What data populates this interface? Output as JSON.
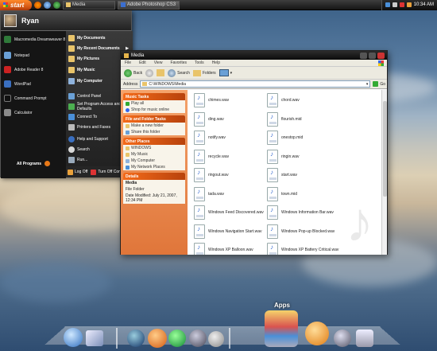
{
  "taskbar": {
    "start_label": "start",
    "tasks": [
      {
        "label": "Media"
      },
      {
        "label": "Adobe Photoshop CS3"
      }
    ],
    "clock": "10:34 AM"
  },
  "start_menu": {
    "user_name": "Ryan",
    "left_items": [
      {
        "label": "Macromedia Dreamweaver 8",
        "color": "#2f7a3a"
      },
      {
        "label": "Notepad",
        "color": "#6aa0d6"
      },
      {
        "label": "Adobe Reader 8",
        "color": "#c22"
      },
      {
        "label": "WordPad",
        "color": "#3a6fc0"
      },
      {
        "label": "Command Prompt",
        "color": "#222"
      },
      {
        "label": "Calculator",
        "color": "#8a8a8a"
      }
    ],
    "all_programs": "All Programs",
    "right_items": [
      {
        "label": "My Documents",
        "bold": true,
        "arrow": false
      },
      {
        "label": "My Recent Documents",
        "bold": true,
        "arrow": true
      },
      {
        "label": "My Pictures",
        "bold": true,
        "arrow": false
      },
      {
        "label": "My Music",
        "bold": true,
        "arrow": false
      },
      {
        "label": "My Computer",
        "bold": true,
        "arrow": false
      },
      {
        "label": "Control Panel",
        "bold": false,
        "arrow": false
      },
      {
        "label": "Set Program Access and Defaults",
        "bold": false,
        "arrow": false
      },
      {
        "label": "Connect To",
        "bold": false,
        "arrow": true
      },
      {
        "label": "Printers and Faxes",
        "bold": false,
        "arrow": false
      },
      {
        "label": "Help and Support",
        "bold": false,
        "arrow": false
      },
      {
        "label": "Search",
        "bold": false,
        "arrow": false
      },
      {
        "label": "Run...",
        "bold": false,
        "arrow": false
      }
    ],
    "log_off": "Log Off",
    "turn_off": "Turn Off Computer"
  },
  "explorer": {
    "title": "Media",
    "menu": [
      "File",
      "Edit",
      "View",
      "Favorites",
      "Tools",
      "Help"
    ],
    "toolbar": {
      "back": "Back",
      "search": "Search",
      "folders": "Folders"
    },
    "address_label": "Address",
    "address": "C:\\WINDOWS\\Media",
    "go": "Go",
    "task_pane": {
      "music_tasks": {
        "title": "Music Tasks",
        "items": [
          "Play all",
          "Shop for music online"
        ]
      },
      "file_tasks": {
        "title": "File and Folder Tasks",
        "items": [
          "Make a new folder",
          "Share this folder"
        ]
      },
      "other_places": {
        "title": "Other Places",
        "items": [
          "WINDOWS",
          "My Music",
          "My Computer",
          "My Network Places"
        ]
      },
      "details": {
        "title": "Details",
        "name": "Media",
        "type": "File Folder",
        "modified": "Date Modified: July 21, 2007, 12:34 PM"
      }
    },
    "files": [
      "chimes.wav",
      "chord.wav",
      "ding.wav",
      "flourish.mid",
      "notify.wav",
      "onestop.mid",
      "recycle.wav",
      "ringin.wav",
      "ringout.wav",
      "start.wav",
      "tada.wav",
      "town.mid",
      "Windows Feed Discovered.wav",
      "Windows Information Bar.wav",
      "Windows Navigation Start.wav",
      "Windows Pop-up Blocked.wav",
      "Windows XP Balloon.wav",
      "Windows XP Battery Critical.wav"
    ]
  },
  "dock": {
    "label": "Apps"
  }
}
